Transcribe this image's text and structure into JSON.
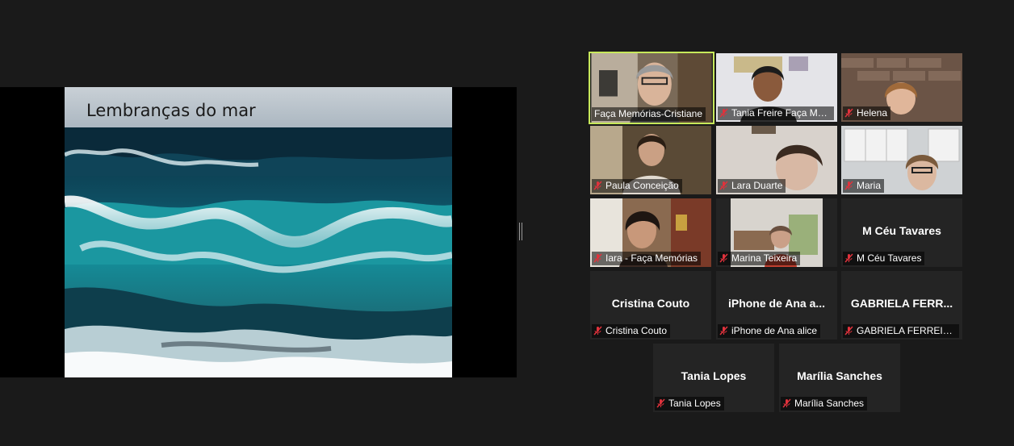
{
  "slide": {
    "title": "Lembranças do mar"
  },
  "participants": [
    {
      "name": "Faça Memórias-Cristiane",
      "muted": false,
      "video": true
    },
    {
      "name": "Tania Freire Faça Me...",
      "muted": true,
      "video": true
    },
    {
      "name": "Helena",
      "muted": true,
      "video": true
    },
    {
      "name": "Paula Conceição",
      "muted": true,
      "video": true
    },
    {
      "name": "Lara Duarte",
      "muted": true,
      "video": true
    },
    {
      "name": "Maria",
      "muted": true,
      "video": true
    },
    {
      "name": "Iara - Faça Memórias",
      "muted": true,
      "video": true
    },
    {
      "name": "Marina Teixeira",
      "muted": true,
      "video": true
    },
    {
      "name": "M Céu Tavares",
      "display": "M Céu Tavares",
      "muted": true,
      "video": false
    },
    {
      "name": "Cristina Couto",
      "display": "Cristina Couto",
      "muted": true,
      "video": false
    },
    {
      "name": "iPhone de Ana alice",
      "display": "iPhone de Ana a...",
      "muted": true,
      "video": false
    },
    {
      "name": "GABRIELA FERREIRA",
      "display": "GABRIELA FERR...",
      "muted": true,
      "video": false
    },
    {
      "name": "Tania Lopes",
      "display": "Tania Lopes",
      "muted": true,
      "video": false
    },
    {
      "name": "Marília Sanches",
      "display": "Marília Sanches",
      "muted": true,
      "video": false
    }
  ],
  "colors": {
    "active_speaker_border": "#c7e85a",
    "muted_icon": "#e0323c",
    "tile_bg": "#242424"
  },
  "icons": {
    "muted": "mic-muted-icon"
  }
}
